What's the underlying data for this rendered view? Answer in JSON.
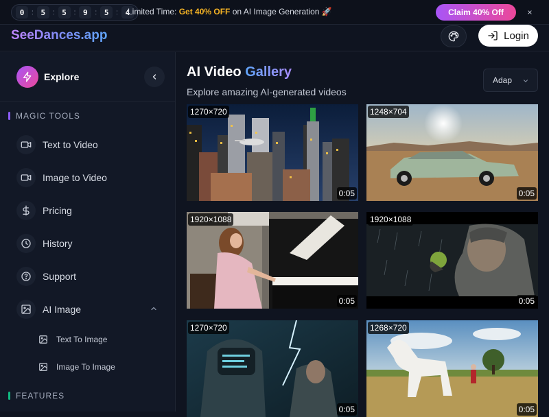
{
  "promo": {
    "countdown_digits": [
      "0",
      "5",
      "5",
      "9",
      "5",
      "4"
    ],
    "text_prefix": "Limited Time: ",
    "text_highlight": "Get 40% OFF",
    "text_suffix": " on AI Image Generation 🚀",
    "claim_label": "Claim 40% Off",
    "close_icon": "×"
  },
  "header": {
    "logo": "SeeDances.app",
    "login_label": "Login"
  },
  "sidebar": {
    "explore_label": "Explore",
    "sections": [
      {
        "label": "MAGIC TOOLS",
        "color": "#8b5cf6"
      },
      {
        "label": "FEATURES",
        "color": "#10b981"
      }
    ],
    "items": [
      {
        "label": "Text to Video",
        "icon": "video-camera-icon"
      },
      {
        "label": "Image to Video",
        "icon": "video-camera-icon"
      },
      {
        "label": "Pricing",
        "icon": "dollar-icon"
      },
      {
        "label": "History",
        "icon": "clock-icon"
      },
      {
        "label": "Support",
        "icon": "help-circle-icon"
      },
      {
        "label": "AI Image",
        "icon": "image-icon"
      }
    ],
    "sub_items": [
      {
        "label": "Text To Image",
        "icon": "image-icon"
      },
      {
        "label": "Image To Image",
        "icon": "image-icon"
      }
    ]
  },
  "main": {
    "title_plain": "AI Video ",
    "title_accent": "Gallery",
    "subtitle": "Explore amazing AI-generated videos",
    "select_value": "Adap"
  },
  "gallery": [
    {
      "resolution": "1270×720",
      "duration": "0:05",
      "scene": "city-skyline-helicopter"
    },
    {
      "resolution": "1248×704",
      "duration": "0:05",
      "scene": "vintage-car-desert-sunset"
    },
    {
      "resolution": "1920×1088",
      "duration": "0:05",
      "scene": "girl-playing-piano"
    },
    {
      "resolution": "1920×1088",
      "duration": "0:05",
      "scene": "man-in-rain-apple"
    },
    {
      "resolution": "1270×720",
      "duration": "0:05",
      "scene": "robot-soldier-lightning"
    },
    {
      "resolution": "1268×720",
      "duration": "0:05",
      "scene": "white-horse-meadow"
    }
  ]
}
